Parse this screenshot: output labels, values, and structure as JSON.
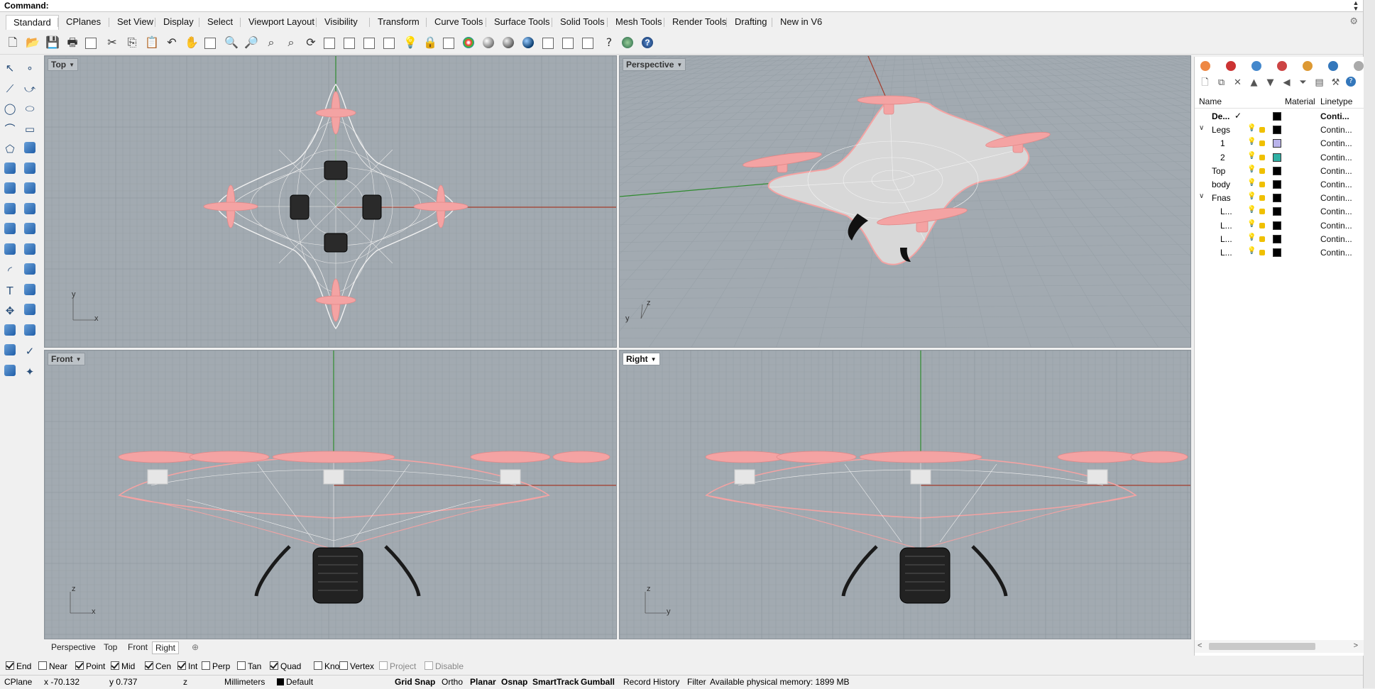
{
  "command": {
    "label": "Command:",
    "value": ""
  },
  "tabs": [
    "Standard",
    "CPlanes",
    "Set View",
    "Display",
    "Select",
    "Viewport Layout",
    "Visibility",
    "Transform",
    "Curve Tools",
    "Surface Tools",
    "Solid Tools",
    "Mesh Tools",
    "Render Tools",
    "Drafting",
    "New in V6"
  ],
  "active_tab": "Standard",
  "viewports": {
    "top": {
      "title": "Top",
      "axis1": "y",
      "axis2": "x"
    },
    "perspective": {
      "title": "Perspective",
      "axis1": "z",
      "axis2": "y"
    },
    "front": {
      "title": "Front",
      "axis1": "z",
      "axis2": "x"
    },
    "right": {
      "title": "Right",
      "axis1": "z",
      "axis2": "y"
    }
  },
  "viewport_tabs": [
    "Perspective",
    "Top",
    "Front",
    "Right"
  ],
  "osnaps": [
    {
      "label": "End",
      "on": true
    },
    {
      "label": "Near",
      "on": false
    },
    {
      "label": "Point",
      "on": true
    },
    {
      "label": "Mid",
      "on": true
    },
    {
      "label": "Cen",
      "on": true
    },
    {
      "label": "Int",
      "on": true
    },
    {
      "label": "Perp",
      "on": false
    },
    {
      "label": "Tan",
      "on": false
    },
    {
      "label": "Quad",
      "on": true
    },
    {
      "label": "Knot",
      "on": false
    },
    {
      "label": "Vertex",
      "on": false
    },
    {
      "label": "Project",
      "on": false
    },
    {
      "label": "Disable",
      "on": false
    }
  ],
  "status": {
    "cplane": "CPlane",
    "x": "x -70.132",
    "y": "y 0.737",
    "z": "z",
    "units": "Millimeters",
    "layer": "Default",
    "toggles": [
      "Grid Snap",
      "Ortho",
      "Planar",
      "Osnap",
      "SmartTrack",
      "Gumball",
      "Record History",
      "Filter"
    ],
    "memory": "Available physical memory: 1899 MB"
  },
  "layers": {
    "headers": {
      "name": "Name",
      "material": "Material",
      "linetype": "Linetype"
    },
    "rows": [
      {
        "name": "De...",
        "indent": 0,
        "current": true,
        "color": "#000000",
        "linetype": "Conti..."
      },
      {
        "name": "Legs",
        "indent": 0,
        "expand": true,
        "color": "#000000",
        "linetype": "Contin..."
      },
      {
        "name": "1",
        "indent": 2,
        "color": "#b9b3ea",
        "linetype": "Contin..."
      },
      {
        "name": "2",
        "indent": 2,
        "color": "#2fb0a4",
        "linetype": "Contin..."
      },
      {
        "name": "Top",
        "indent": 0,
        "color": "#000000",
        "linetype": "Contin..."
      },
      {
        "name": "body",
        "indent": 0,
        "color": "#000000",
        "linetype": "Contin..."
      },
      {
        "name": "Fnas",
        "indent": 0,
        "expand": true,
        "color": "#000000",
        "linetype": "Contin..."
      },
      {
        "name": "L...",
        "indent": 2,
        "color": "#000000",
        "linetype": "Contin..."
      },
      {
        "name": "L...",
        "indent": 2,
        "color": "#000000",
        "linetype": "Contin..."
      },
      {
        "name": "L...",
        "indent": 2,
        "color": "#000000",
        "linetype": "Contin..."
      },
      {
        "name": "L...",
        "indent": 2,
        "color": "#000000",
        "linetype": "Contin..."
      }
    ]
  },
  "colors": {
    "viewport_bg": "#a2aab1",
    "grid": "#97a0a7",
    "grid_major": "#8a939a",
    "x_axis": "#a23b2b",
    "y_axis": "#2f8b2f",
    "selected": "#f4a3a3",
    "wire": "#f2f2f2"
  }
}
